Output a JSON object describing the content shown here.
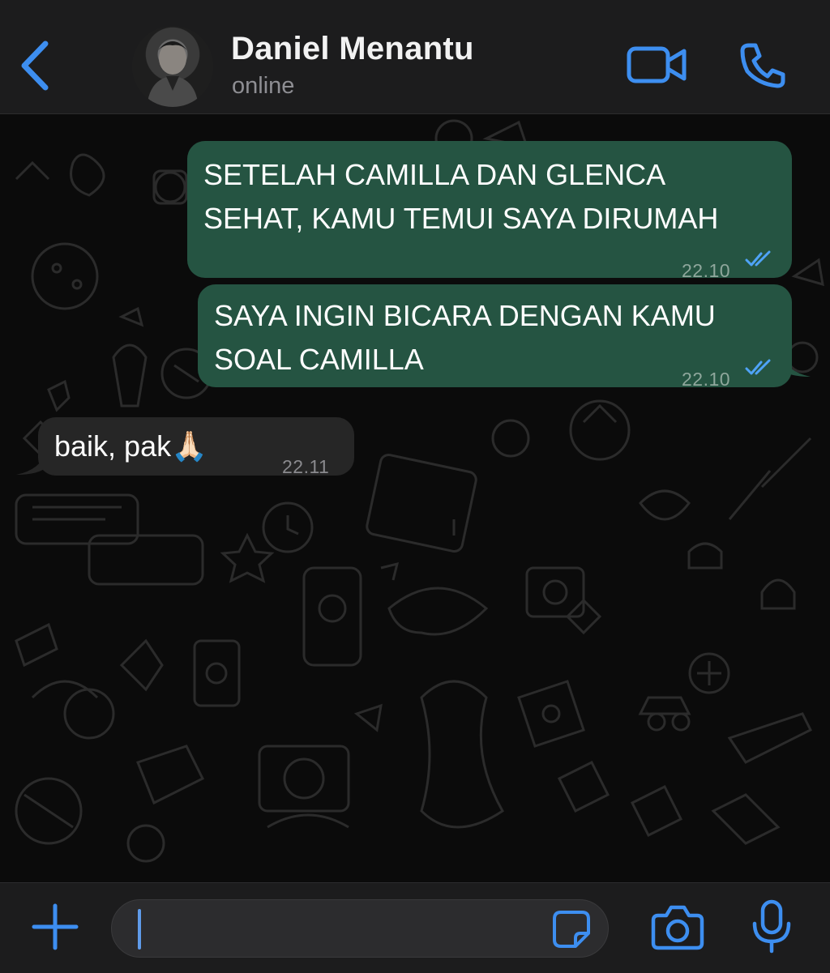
{
  "header": {
    "back_icon": "chevron-left-icon",
    "contact_name": "Daniel Menantu",
    "status": "online",
    "video_icon": "video-camera-icon",
    "call_icon": "phone-icon",
    "accent_color": "#3d8ef0"
  },
  "messages": [
    {
      "direction": "outgoing",
      "lines": [
        "SETELAH CAMILLA DAN GLENCA",
        "SEHAT, KAMU TEMUI SAYA DIRUMAH"
      ],
      "time": "22.10",
      "status": "read"
    },
    {
      "direction": "outgoing",
      "lines": [
        "SAYA INGIN BICARA DENGAN KAMU",
        "SOAL CAMILLA"
      ],
      "time": "22.10",
      "status": "read"
    },
    {
      "direction": "incoming",
      "lines": [
        "baik, pak🙏🏻"
      ],
      "time": "22.11"
    }
  ],
  "composer": {
    "plus_icon": "plus-icon",
    "value": "",
    "sticker_icon": "sticker-icon",
    "camera_icon": "camera-icon",
    "mic_icon": "microphone-icon"
  },
  "colors": {
    "outgoing_bubble": "#255442",
    "incoming_bubble": "#262626",
    "read_ticks": "#4fa3f7"
  }
}
